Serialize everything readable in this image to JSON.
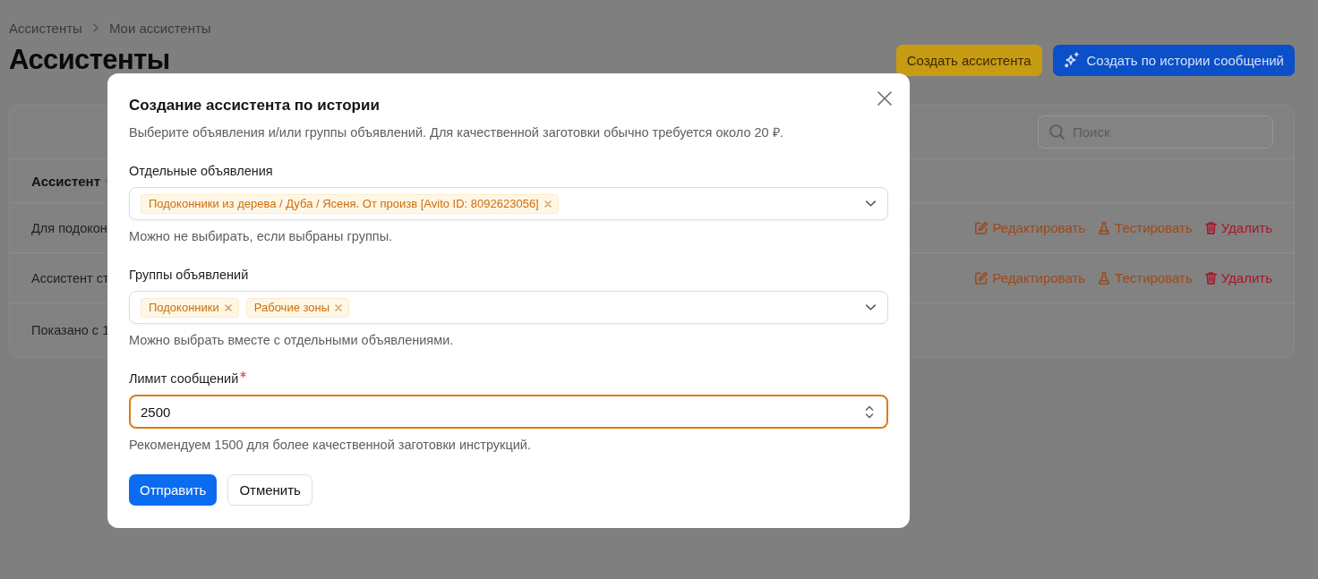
{
  "breadcrumb": [
    {
      "label": "Ассистенты"
    },
    {
      "label": "Мои ассистенты"
    }
  ],
  "page_title": "Ассистенты",
  "header_buttons": [
    {
      "label": "Создать ассистента",
      "kind": "plain"
    },
    {
      "label": "Создать по истории сообщений",
      "kind": "ai"
    }
  ],
  "table": {
    "search": {
      "placeholder": "Поиск"
    },
    "columns": [
      {
        "label": "Ассистент"
      }
    ],
    "rows": [
      {
        "name": "Для подокон",
        "actions": [
          {
            "label": "Редактировать",
            "kind": "edit"
          },
          {
            "label": "Тестировать",
            "kind": "test"
          },
          {
            "label": "Удалить",
            "kind": "delete"
          }
        ]
      },
      {
        "name": "Ассистент ст",
        "actions": [
          {
            "label": "Редактировать",
            "kind": "edit"
          },
          {
            "label": "Тестировать",
            "kind": "test"
          },
          {
            "label": "Удалить",
            "kind": "delete"
          }
        ]
      }
    ],
    "footer": "Показано с 1"
  },
  "modal": {
    "title": "Создание ассистента по истории",
    "description": "Выберите объявления и/или группы объявлений. Для качественной заготовки обычно требуется около 20 ₽.",
    "fields": [
      {
        "kind": "multiselect",
        "label": "Отдельные объявления",
        "tags": [
          {
            "label": "Подоконники из дерева / Дуба / Ясеня. От произв [Avito ID: 8092623056]"
          }
        ],
        "hint": "Можно не выбирать, если выбраны группы."
      },
      {
        "kind": "multiselect",
        "label": "Группы объявлений",
        "tags": [
          {
            "label": "Подоконники"
          },
          {
            "label": "Рабочие зоны"
          }
        ],
        "hint": "Можно выбрать вместе с отдельными объявлениями."
      },
      {
        "kind": "number",
        "label": "Лимит сообщений",
        "required": true,
        "value": "2500",
        "focused": true,
        "hint": "Рекомендуем 1500 для более качественной заготовки инструкций."
      }
    ],
    "buttons": [
      {
        "label": "Отправить",
        "kind": "primary"
      },
      {
        "label": "Отменить",
        "kind": "default"
      }
    ]
  }
}
